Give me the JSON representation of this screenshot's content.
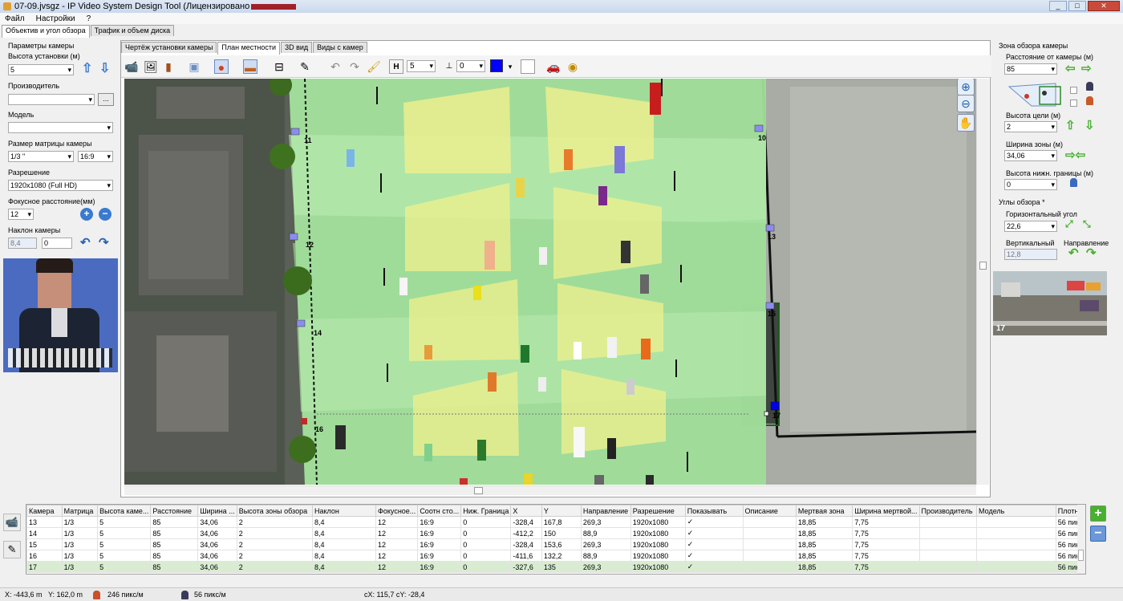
{
  "window": {
    "title": "07-09.jvsgz - IP Video System Design Tool (Лицензировано"
  },
  "menu": {
    "items": [
      "Файл",
      "Настройки",
      "?"
    ]
  },
  "left_tabs": [
    "Объектив и угол обзора",
    "Трафик и объем диска"
  ],
  "left": {
    "camera_params": "Параметры камеры",
    "install_height_label": "Высота установки (м)",
    "install_height_value": "5",
    "manufacturer_label": "Производитель",
    "manufacturer_value": "",
    "browse_label": "...",
    "model_label": "Модель",
    "model_value": "",
    "sensor_label": "Размер матрицы камеры",
    "sensor_value": "1/3 \"",
    "aspect_value": "16:9",
    "resolution_label": "Разрешение",
    "resolution_value": "1920x1080 (Full HD)",
    "focal_label": "Фокусное расстояние(мм)",
    "focal_value": "12",
    "tilt_label": "Наклон камеры",
    "tilt_value": "8,4",
    "tilt_value2": "0"
  },
  "main_tabs": [
    "Чертёж установки камеры",
    "План местности",
    "3D вид",
    "Виды с камер"
  ],
  "toolbar": {
    "h_label": "H",
    "h_value": "5",
    "w_value": "0",
    "color": "#0000ff"
  },
  "map": {
    "camera_labels": [
      "11",
      "10",
      "12",
      "13",
      "14",
      "15",
      "16",
      "17"
    ]
  },
  "right": {
    "zone_title": "Зона обзора камеры",
    "distance_label": "Расстояние от камеры (м)",
    "distance_value": "85",
    "target_height_label": "Высота цели (м)",
    "target_height_value": "2",
    "zone_width_label": "Ширина зоны (м)",
    "zone_width_value": "34,06",
    "lower_bound_label": "Высота нижн. границы (м)",
    "lower_bound_value": "0",
    "angles_title": "Углы обзора *",
    "horizontal_label": "Горизонтальный угол",
    "horizontal_value": "22,6",
    "vertical_label": "Вертикальный",
    "vertical_value": "12,8",
    "direction_label": "Направление",
    "preview_number": "17"
  },
  "table": {
    "columns": [
      "Камера",
      "Матрица",
      "Высота каме...",
      "Расстояние",
      "Ширина ...",
      "Высота зоны обзора",
      "Наклон",
      "Фокусное...",
      "Соотн сто...",
      "Ниж. Граница",
      "X",
      "Y",
      "Направление",
      "Разрешение",
      "Показывать",
      "Описание",
      "Мертвая зона",
      "Ширина мертвой...",
      "Производитель",
      "Модель",
      "Плотн"
    ],
    "rows": [
      [
        "13",
        "1/3",
        "5",
        "85",
        "34,06",
        "2",
        "8,4",
        "12",
        "16:9",
        "0",
        "-328,4",
        "167,8",
        "269,3",
        "1920x1080",
        "✓",
        "",
        "18,85",
        "7,75",
        "",
        "",
        "56 пик"
      ],
      [
        "14",
        "1/3",
        "5",
        "85",
        "34,06",
        "2",
        "8,4",
        "12",
        "16:9",
        "0",
        "-412,2",
        "150",
        "88,9",
        "1920x1080",
        "✓",
        "",
        "18,85",
        "7,75",
        "",
        "",
        "56 пик"
      ],
      [
        "15",
        "1/3",
        "5",
        "85",
        "34,06",
        "2",
        "8,4",
        "12",
        "16:9",
        "0",
        "-328,4",
        "153,6",
        "269,3",
        "1920x1080",
        "✓",
        "",
        "18,85",
        "7,75",
        "",
        "",
        "56 пик"
      ],
      [
        "16",
        "1/3",
        "5",
        "85",
        "34,06",
        "2",
        "8,4",
        "12",
        "16:9",
        "0",
        "-411,6",
        "132,2",
        "88,9",
        "1920x1080",
        "✓",
        "",
        "18,85",
        "7,75",
        "",
        "",
        "56 пик"
      ],
      [
        "17",
        "1/3",
        "5",
        "85",
        "34,06",
        "2",
        "8,4",
        "12",
        "16:9",
        "0",
        "-327,6",
        "135",
        "269,3",
        "1920x1080",
        "✓",
        "",
        "18,85",
        "7,75",
        "",
        "",
        "56 пик"
      ]
    ],
    "selected_row": "17"
  },
  "status": {
    "x": "X: -443,6 m",
    "y": "Y: 162,0 m",
    "density1": "246 пикс/м",
    "density2": "56 пикс/м",
    "cxy": "cX: 115,7 cY: -28,4"
  },
  "colors": {
    "accent": "#3a7ad0",
    "green": "#49b031",
    "selection": "#d9ecd2",
    "zone_green": "#a6e6a0",
    "zone_yellow": "#f0f08c"
  }
}
